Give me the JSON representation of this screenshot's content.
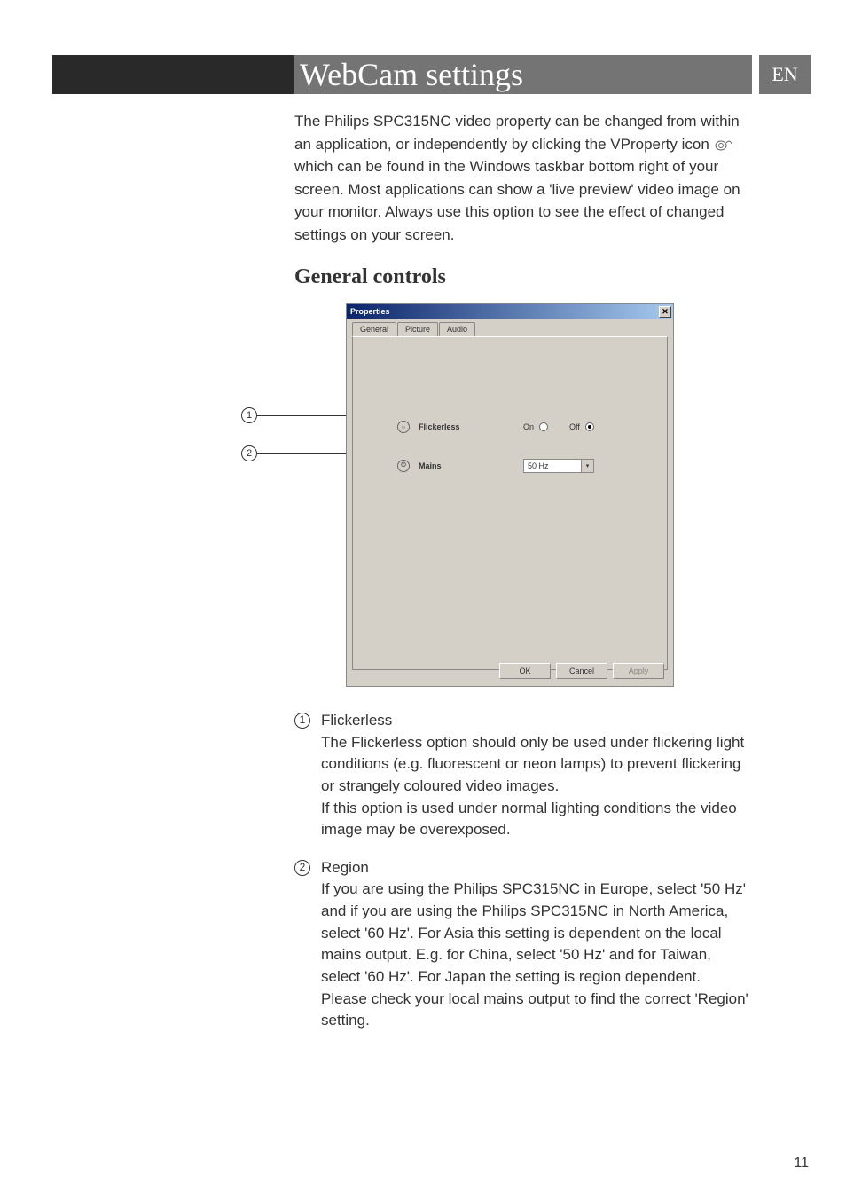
{
  "lang": "EN",
  "page_title": "WebCam settings",
  "intro": {
    "p1a": "The Philips SPC315NC video property can be changed from within an application, or independently by clicking the VProperty icon ",
    "p1b": " which can be found in the Windows taskbar bottom right of your screen. Most applications can show a 'live preview' video image on your monitor. Always use this option to see the effect of changed settings on your screen."
  },
  "section_heading": "General controls",
  "callouts": {
    "c1": "1",
    "c2": "2"
  },
  "dialog": {
    "title": "Properties",
    "tabs": [
      "General",
      "Picture",
      "Audio"
    ],
    "flickerless": {
      "label": "Flickerless",
      "on": "On",
      "off": "Off"
    },
    "mains": {
      "label": "Mains",
      "value": "50 Hz"
    },
    "buttons": {
      "ok": "OK",
      "cancel": "Cancel",
      "apply": "Apply"
    }
  },
  "notes": {
    "n1": {
      "marker": "1",
      "title": "Flickerless",
      "body": "The Flickerless option should only be used under flickering light conditions (e.g. fluorescent or neon lamps) to prevent flickering or strangely coloured video images.\nIf this option is used under normal lighting conditions the video image may be overexposed."
    },
    "n2": {
      "marker": "2",
      "title": "Region",
      "body": "If you are using the Philips SPC315NC in Europe, select '50 Hz' and if you are using the Philips SPC315NC in North America, select '60 Hz'. For Asia this setting is dependent on the local mains output. E.g. for China, select '50 Hz' and for Taiwan, select '60 Hz'. For Japan the setting is region dependent.\nPlease check your local mains output to find the correct 'Region' setting."
    }
  },
  "page_number": "11"
}
